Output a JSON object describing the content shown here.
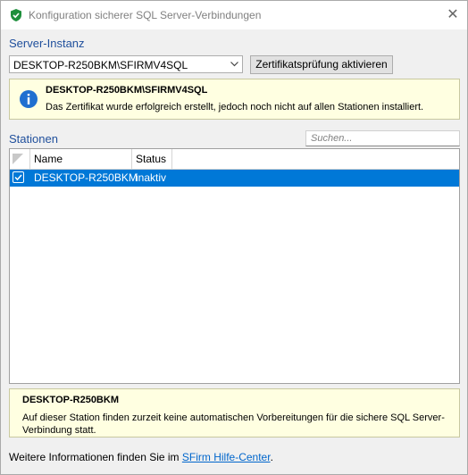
{
  "window": {
    "title": "Konfiguration sicherer SQL Server-Verbindungen",
    "close_symbol": "✕"
  },
  "server": {
    "label": "Server-Instanz",
    "selected": "DESKTOP-R250BKM\\SFIRMV4SQL",
    "button": "Zertifikatsprüfung aktivieren"
  },
  "info": {
    "title": "DESKTOP-R250BKM\\SFIRMV4SQL",
    "text": "Das Zertifikat wurde erfolgreich erstellt, jedoch noch nicht auf allen Stationen installiert."
  },
  "stations": {
    "label": "Stationen",
    "search_placeholder": "Suchen...",
    "columns": [
      "Name",
      "Status"
    ],
    "rows": [
      {
        "checked": true,
        "name": "DESKTOP-R250BKM",
        "status": "inaktiv"
      }
    ]
  },
  "detail": {
    "title": "DESKTOP-R250BKM",
    "text": "Auf dieser Station finden zurzeit keine automatischen Vorbereitungen für die sichere SQL Server-Verbindung statt."
  },
  "footer": {
    "prefix": "Weitere Informationen finden Sie im ",
    "link": "SFirm Hilfe-Center",
    "suffix": "."
  },
  "colors": {
    "accent": "#0078d7",
    "label_blue": "#1f4f9c",
    "info_bg": "#ffffe1",
    "link": "#0066cc"
  }
}
